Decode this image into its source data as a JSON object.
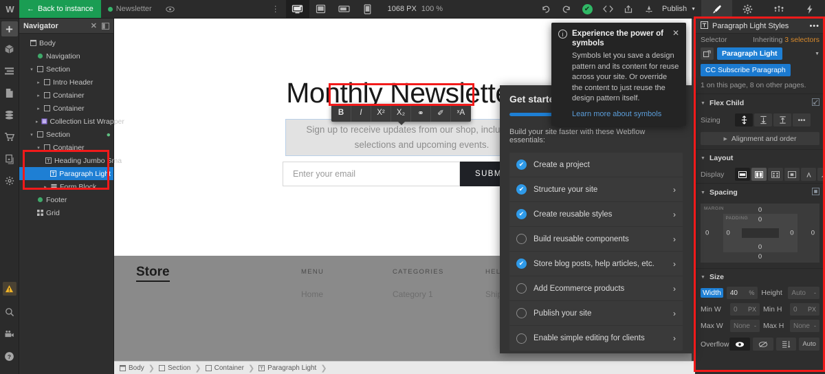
{
  "topbar": {
    "logo": "W",
    "back_label": "Back to instance",
    "page_name": "Newsletter",
    "preview_icon": "eye-icon",
    "kebab_icon": "kebab-icon",
    "viewports": [
      {
        "name": "desktop",
        "icon": "desktop-icon",
        "active": true
      },
      {
        "name": "tablet",
        "icon": "tablet-icon",
        "active": false
      },
      {
        "name": "mobile-landscape",
        "icon": "mobile-landscape-icon",
        "active": false
      },
      {
        "name": "mobile-portrait",
        "icon": "mobile-portrait-icon",
        "active": false
      }
    ],
    "canvas_width": "1068 PX",
    "canvas_zoom": "100 %",
    "undo_icon": "undo-icon",
    "redo_icon": "redo-icon",
    "save_status_icon": "checkmark-saved-icon",
    "code_icon": "code-brackets-icon",
    "share_icon": "share-icon",
    "audit_icon": "audit-icon",
    "publish_label": "Publish",
    "right_tabs": [
      {
        "name": "style-panel",
        "icon": "brush-icon",
        "active": true
      },
      {
        "name": "settings-panel",
        "icon": "gear-icon",
        "active": false
      },
      {
        "name": "interactions-panel",
        "icon": "interactions-icon",
        "active": false
      },
      {
        "name": "effects-panel",
        "icon": "lightning-icon",
        "active": false
      }
    ]
  },
  "rail": {
    "items": [
      {
        "name": "add-elements",
        "icon": "plus-icon",
        "boxed": true
      },
      {
        "name": "components",
        "icon": "cube-icon",
        "boxed": false
      },
      {
        "name": "navigator",
        "icon": "layers-icon",
        "boxed": false
      },
      {
        "name": "pages",
        "icon": "page-icon",
        "boxed": false
      },
      {
        "name": "cms",
        "icon": "database-icon",
        "boxed": false
      },
      {
        "name": "ecommerce",
        "icon": "cart-icon",
        "boxed": false
      },
      {
        "name": "assets",
        "icon": "assets-icon",
        "boxed": false
      },
      {
        "name": "project-settings",
        "icon": "gear-icon",
        "boxed": false
      }
    ],
    "bottom": [
      {
        "name": "warnings",
        "icon": "warning-triangle-icon"
      },
      {
        "name": "search",
        "icon": "magnifier-icon"
      },
      {
        "name": "video-tutorials",
        "icon": "video-icon"
      },
      {
        "name": "help",
        "icon": "question-circle-icon"
      }
    ]
  },
  "navigator": {
    "title": "Navigator",
    "close_icon": "close-icon",
    "collapse_icon": "panel-collapse-icon",
    "tree": [
      {
        "label": "Body",
        "depth": 0,
        "icon": "body-icon",
        "twisty": "",
        "selected": false
      },
      {
        "label": "Navigation",
        "depth": 1,
        "icon": "symbol-icon",
        "twisty": "",
        "selected": false
      },
      {
        "label": "Section",
        "depth": 1,
        "icon": "section-icon",
        "twisty": "▾",
        "selected": false
      },
      {
        "label": "Intro Header",
        "depth": 2,
        "icon": "div-icon",
        "twisty": "▸",
        "selected": false
      },
      {
        "label": "Container",
        "depth": 2,
        "icon": "div-icon",
        "twisty": "▸",
        "selected": false
      },
      {
        "label": "Container",
        "depth": 2,
        "icon": "div-icon",
        "twisty": "▸",
        "selected": false
      },
      {
        "label": "Collection List Wrapper",
        "depth": 2,
        "icon": "collection-icon",
        "twisty": "▸",
        "selected": false
      },
      {
        "label": "Section",
        "depth": 1,
        "icon": "section-icon",
        "twisty": "▾",
        "selected": false,
        "gear": true
      },
      {
        "label": "Container",
        "depth": 2,
        "icon": "div-icon",
        "twisty": "▾",
        "selected": false
      },
      {
        "label": "Heading Jumbo Sma",
        "depth": 3,
        "icon": "text-icon",
        "twisty": "",
        "selected": false
      },
      {
        "label": "Paragraph Light",
        "depth": 3,
        "icon": "text-icon",
        "twisty": "",
        "selected": true
      },
      {
        "label": "Form Block",
        "depth": 3,
        "icon": "form-icon",
        "twisty": "▸",
        "selected": false
      },
      {
        "label": "Footer",
        "depth": 1,
        "icon": "symbol-icon",
        "twisty": "",
        "selected": false
      },
      {
        "label": "Grid",
        "depth": 1,
        "icon": "grid-icon",
        "twisty": "",
        "selected": false
      }
    ]
  },
  "canvas": {
    "hero_title": "Monthly Newsletter",
    "hero_paragraph": "Sign up to receive updates from our shop, including new selections and upcoming events.",
    "email_placeholder": "Enter your email",
    "submit_label": "SUBMIT",
    "footer": {
      "logo": "Store",
      "columns": [
        {
          "heading": "MENU",
          "link": "Home"
        },
        {
          "heading": "CATEGORIES",
          "link": "Category 1"
        },
        {
          "heading": "HELP",
          "link": "Shipping"
        }
      ]
    },
    "rich_text_toolbar": [
      {
        "name": "bold-button",
        "label": "B"
      },
      {
        "name": "italic-button",
        "label": "I"
      },
      {
        "name": "superscript-button",
        "label": "X²"
      },
      {
        "name": "subscript-button",
        "label": "X₂"
      },
      {
        "name": "link-button",
        "label": "⚭"
      },
      {
        "name": "style-brush-button",
        "label": "✐"
      },
      {
        "name": "clear-formatting-button",
        "label": "ˣA"
      }
    ]
  },
  "symbols_popup": {
    "info_icon": "info-icon",
    "title": "Experience the power of symbols",
    "body": "Symbols let you save a design pattern and its content for reuse across your site. Or override the content to just reuse the design pattern itself.",
    "link": "Learn more about symbols",
    "close_icon": "close-icon"
  },
  "get_started": {
    "title": "Get started",
    "progress_percent": 50,
    "description": "Build your site faster with these Webflow essentials:",
    "items": [
      {
        "label": "Create a project",
        "done": true,
        "chevron": false
      },
      {
        "label": "Structure your site",
        "done": true,
        "chevron": true
      },
      {
        "label": "Create reusable styles",
        "done": true,
        "chevron": true
      },
      {
        "label": "Build reusable components",
        "done": false,
        "chevron": true
      },
      {
        "label": "Store blog posts, help articles, etc.",
        "done": true,
        "chevron": true
      },
      {
        "label": "Add Ecommerce products",
        "done": false,
        "chevron": true
      },
      {
        "label": "Publish your site",
        "done": false,
        "chevron": true
      },
      {
        "label": "Enable simple editing for clients",
        "done": false,
        "chevron": true
      }
    ]
  },
  "style_panel": {
    "header_title": "Paragraph Light Styles",
    "header_menu_icon": "kebab-icon",
    "header_tag_icon": "text-element-icon",
    "selector_label": "Selector",
    "inheriting_prefix": "Inheriting ",
    "inheriting_count": "3 selectors",
    "class_primary": "Paragraph Light",
    "class_secondary": "CC Subscribe Paragraph",
    "selector_usage": "1 on this page, 8 on other pages.",
    "flex_child": {
      "title": "Flex Child",
      "sizing_label": "Sizing",
      "sizing_options": [
        {
          "name": "sizing-grow",
          "active": true
        },
        {
          "name": "sizing-shrink",
          "active": false
        },
        {
          "name": "sizing-no-shrink",
          "active": false
        },
        {
          "name": "sizing-more",
          "active": false
        }
      ],
      "alignment_label": "Alignment and order"
    },
    "layout": {
      "title": "Layout",
      "display_label": "Display",
      "display_options": [
        {
          "name": "display-block",
          "active": true
        },
        {
          "name": "display-flex",
          "active": false,
          "on": true
        },
        {
          "name": "display-grid",
          "active": false
        },
        {
          "name": "display-inline-block",
          "active": false
        },
        {
          "name": "display-inline",
          "active": false
        },
        {
          "name": "display-none",
          "active": false
        }
      ]
    },
    "spacing": {
      "title": "Spacing",
      "margin_label": "MARGIN",
      "padding_label": "PADDING",
      "margin": {
        "top": "0",
        "right": "0",
        "bottom": "0",
        "left": "0"
      },
      "padding": {
        "top": "0",
        "right": "0",
        "bottom": "0",
        "left": "0"
      }
    },
    "size": {
      "title": "Size",
      "width_label": "Width",
      "width_value": "40",
      "width_unit": "%",
      "height_label": "Height",
      "height_value": "Auto",
      "minw_label": "Min W",
      "minw_value": "0",
      "minw_unit": "PX",
      "minh_label": "Min H",
      "minh_value": "0",
      "minh_unit": "PX",
      "maxw_label": "Max W",
      "maxw_value": "None",
      "maxh_label": "Max H",
      "maxh_value": "None",
      "overflow_label": "Overflow",
      "overflow_options": [
        {
          "name": "overflow-visible",
          "label": "◉",
          "active": true
        },
        {
          "name": "overflow-hidden",
          "label": "⊘",
          "active": false
        },
        {
          "name": "overflow-scroll",
          "label": "≣",
          "active": false
        },
        {
          "name": "overflow-auto",
          "label": "Auto",
          "active": false
        }
      ]
    }
  },
  "breadcrumb": {
    "items": [
      {
        "label": "Body",
        "icon": "body-icon"
      },
      {
        "label": "Section",
        "icon": "section-icon"
      },
      {
        "label": "Container",
        "icon": "div-icon"
      },
      {
        "label": "Paragraph Light",
        "icon": "text-icon"
      }
    ]
  },
  "colors": {
    "accent_blue": "#1e7fd4",
    "brand_green": "#1a9d53",
    "highlight_red": "#f31a1a",
    "orange": "#d98a2b"
  }
}
